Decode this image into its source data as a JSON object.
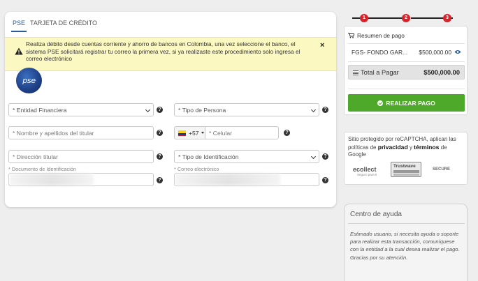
{
  "tabs": [
    {
      "label": "PSE",
      "active": true
    },
    {
      "label": "TARJETA DE CRÉDITO",
      "active": false
    }
  ],
  "alert": {
    "icon": "warning-icon",
    "text": "Realiza débito desde cuentas corriente y ahorro de bancos en Colombia, una vez seleccione el banco, el sistema PSE solicitará registrar tu correo la primera vez, si ya realizaste este procedimiento solo ingresa el correo electrónico",
    "close": "×"
  },
  "logo": {
    "text": "pse"
  },
  "form": {
    "entidad": "* Entidad Financiera",
    "tipo_persona": "* Tipo de Persona",
    "nombre_placeholder": "* Nombre y apellidos del titular",
    "phone_prefix": "+57",
    "celular_placeholder": "* Celular",
    "direccion_placeholder": "* Dirección titular",
    "tipo_identificacion": "* Tipo de Identificación",
    "documento_label": "* Documento de Identificación",
    "correo_label": "* Correo electrónico",
    "help": "?"
  },
  "steps": [
    "1",
    "2",
    "3"
  ],
  "summary": {
    "title": "Resumen de pago",
    "item_name": "FGS- FONDO GAR...",
    "item_amount": "$500,000.00",
    "total_label": "Total a Pagar",
    "total_value": "$500,000.00",
    "pay_button": "REALIZAR PAGO"
  },
  "captcha": {
    "text_1": "Sitio protegido por reCAPTCHA, aplican las políticas de",
    "privacy": "privacidad",
    "and": "y",
    "terms": "términos",
    "text_2": "de Google"
  },
  "partners": {
    "ecollect": "ecollect",
    "ecollect_tag": "Seguro para ti",
    "trustwave": "Trustwave",
    "secure": "SECURE"
  },
  "help_center": {
    "title": "Centro de ayuda",
    "text": "Estimado usuario, si necesita ayuda o soporte para realizar esta transacción, comuníquese con la entidad a la cual desea realizar el pago. Gracias por su atención."
  },
  "colors": {
    "accent": "#2b5c9a",
    "step": "#d9222a",
    "pay": "#4ea82a",
    "alert_bg": "#fcf8c2"
  }
}
